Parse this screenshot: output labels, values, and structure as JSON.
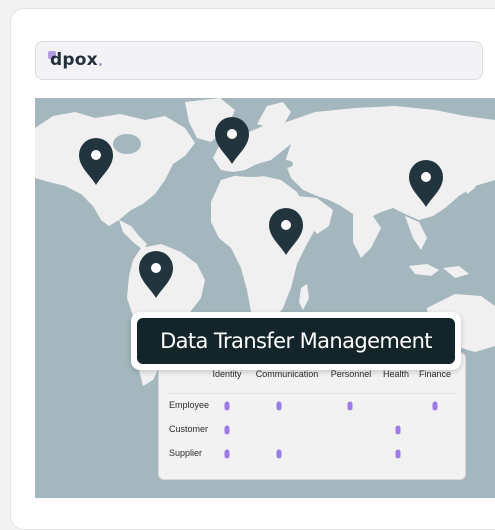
{
  "brand": {
    "name": "dpox",
    "accent_color": "#b79be0"
  },
  "map": {
    "ocean_color": "#a4b7be",
    "land_color": "#f0f0f0",
    "pin_color": "#22353f",
    "pins": [
      {
        "region": "north-america"
      },
      {
        "region": "europe"
      },
      {
        "region": "east-asia"
      },
      {
        "region": "africa"
      },
      {
        "region": "south-america"
      }
    ]
  },
  "banner": {
    "title": "Data Transfer Management"
  },
  "matrix": {
    "dot_color": "#9b7be6",
    "columns": [
      "Identity",
      "Communication",
      "Personnel",
      "Health",
      "Finance"
    ],
    "rows": [
      {
        "label": "Employee",
        "cells": [
          true,
          true,
          true,
          false,
          true
        ]
      },
      {
        "label": "Customer",
        "cells": [
          true,
          false,
          false,
          true,
          false
        ]
      },
      {
        "label": "Supplier",
        "cells": [
          true,
          true,
          false,
          true,
          false
        ]
      }
    ]
  }
}
